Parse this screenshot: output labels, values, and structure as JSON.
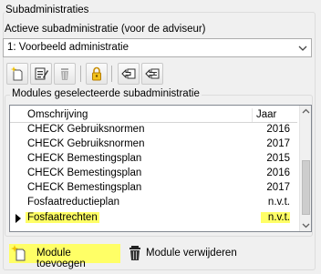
{
  "group_title": "Subadministraties",
  "active_label": "Actieve subadministratie (voor de adviseur)",
  "combo": {
    "value": "1: Voorbeeld administratie"
  },
  "toolbar": {
    "icons": [
      "new-document-icon",
      "edit-document-icon",
      "delete-bin-icon",
      "lock-icon",
      "import-arrow-icon",
      "export-arrow-icon"
    ]
  },
  "modules": {
    "title": "Modules geselecteerde subadministratie",
    "columns": {
      "description": "Omschrijving",
      "year": "Jaar"
    },
    "rows": [
      {
        "description": "CHECK Gebruiksnormen",
        "year": "2016"
      },
      {
        "description": "CHECK Gebruiksnormen",
        "year": "2017"
      },
      {
        "description": "CHECK Bemestingsplan",
        "year": "2015"
      },
      {
        "description": "CHECK Bemestingsplan",
        "year": "2016"
      },
      {
        "description": "CHECK Bemestingsplan",
        "year": "2017"
      },
      {
        "description": "Fosfaatreductieplan",
        "year": "n.v.t."
      },
      {
        "description": "Fosfaatrechten",
        "year": "n.v.t."
      }
    ],
    "current_row_index": 6
  },
  "buttons": {
    "add_label": "Module toevoegen",
    "delete_label": "Module verwijderen"
  },
  "colors": {
    "highlight": "#ffff66"
  }
}
